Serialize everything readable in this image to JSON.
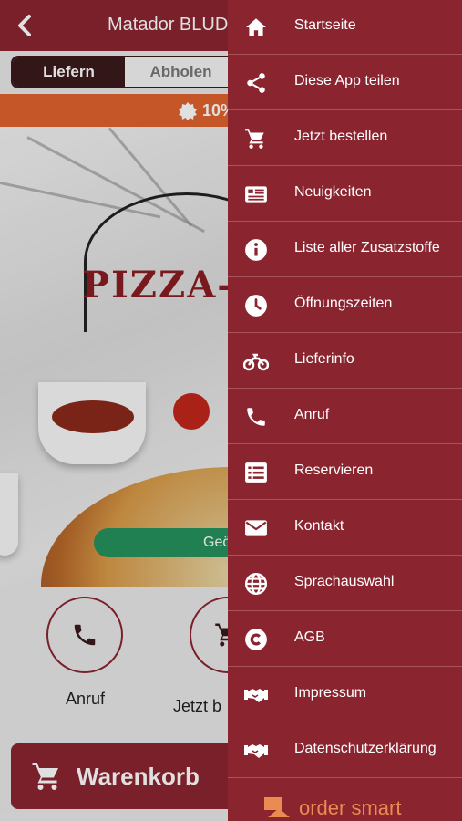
{
  "header": {
    "title": "Matador BLUDE",
    "back_icon": "chevron-left-icon"
  },
  "order_mode": {
    "options": [
      "Liefern",
      "Abholen"
    ],
    "selected": "Liefern"
  },
  "promo": {
    "text": "10%",
    "icon": "badge-icon"
  },
  "hero": {
    "logo_text": "PIZZA-",
    "status_pill": "Geö"
  },
  "quick_actions": [
    {
      "label": "Anruf",
      "icon": "phone-icon"
    },
    {
      "label": "Jetzt b",
      "icon": "cart-icon"
    }
  ],
  "cart_button": {
    "label": "Warenkorb",
    "icon": "cart-icon"
  },
  "drawer": {
    "items": [
      {
        "label": "Startseite",
        "icon": "home-icon"
      },
      {
        "label": "Diese App teilen",
        "icon": "share-icon"
      },
      {
        "label": "Jetzt bestellen",
        "icon": "cart-icon"
      },
      {
        "label": "Neuigkeiten",
        "icon": "news-icon"
      },
      {
        "label": "Liste aller Zusatzstoffe",
        "icon": "info-icon"
      },
      {
        "label": "Öffnungszeiten",
        "icon": "clock-icon"
      },
      {
        "label": "Lieferinfo",
        "icon": "motorbike-icon"
      },
      {
        "label": "Anruf",
        "icon": "phone-icon"
      },
      {
        "label": "Reservieren",
        "icon": "list-icon"
      },
      {
        "label": "Kontakt",
        "icon": "mail-icon"
      },
      {
        "label": "Sprachauswahl",
        "icon": "globe-icon"
      },
      {
        "label": "AGB",
        "icon": "copyright-icon"
      },
      {
        "label": "Impressum",
        "icon": "handshake-icon"
      },
      {
        "label": "Datenschutzerklärung",
        "icon": "handshake-icon"
      }
    ],
    "footer_brand": "order smart"
  },
  "colors": {
    "primary": "#8a2530",
    "promo": "#e0622e",
    "status_green": "#25925e",
    "brand_orange": "#ea8b52"
  }
}
